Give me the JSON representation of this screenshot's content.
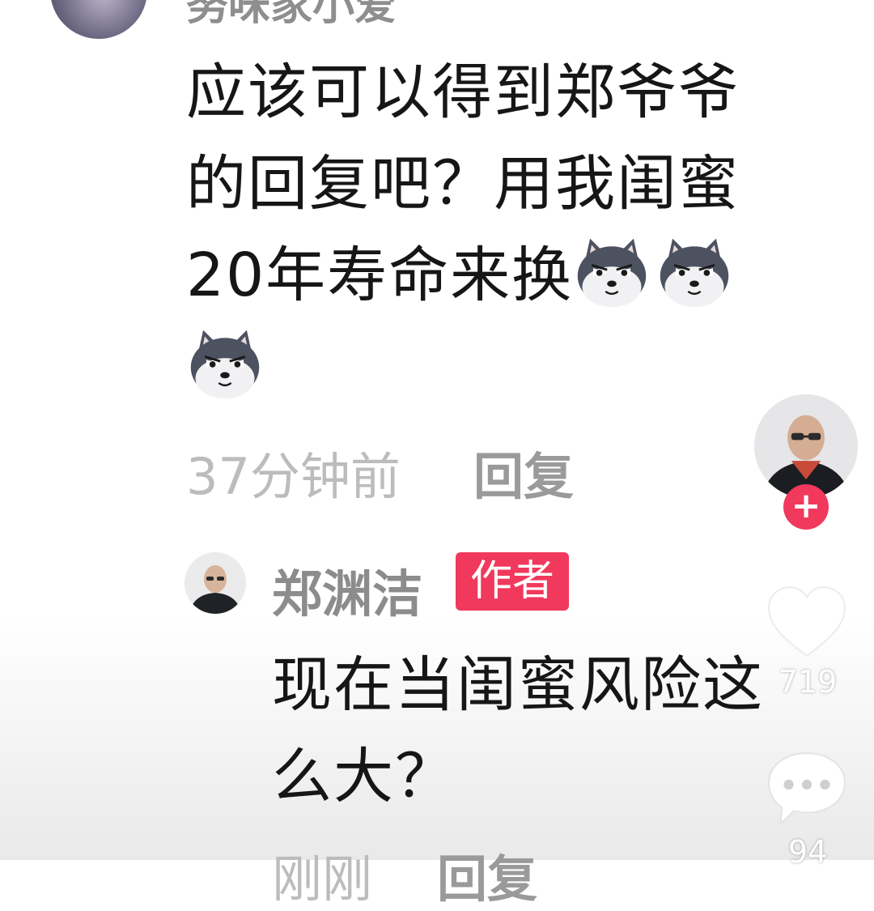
{
  "comment": {
    "username": "努味家小爱",
    "lines": [
      "应该可以得到郑爷爷",
      "的回复吧？用我闺蜜",
      "20年寿命来换"
    ],
    "emoji": "dog-emoji",
    "time": "37分钟前",
    "reply_label": "回复"
  },
  "reply": {
    "username": "郑渊洁",
    "badge": "作者",
    "lines": [
      "现在当闺蜜风险这",
      "么大？"
    ],
    "time": "刚刚",
    "reply_label": "回复"
  },
  "sidebar": {
    "follow_icon": "plus-icon",
    "like_icon": "heart-icon",
    "like_count": "719",
    "comment_icon": "chat-bubble-icon",
    "comment_count": "94"
  },
  "colors": {
    "accent": "#f0395c",
    "text": "#161616",
    "meta": "#bcbcbc"
  }
}
